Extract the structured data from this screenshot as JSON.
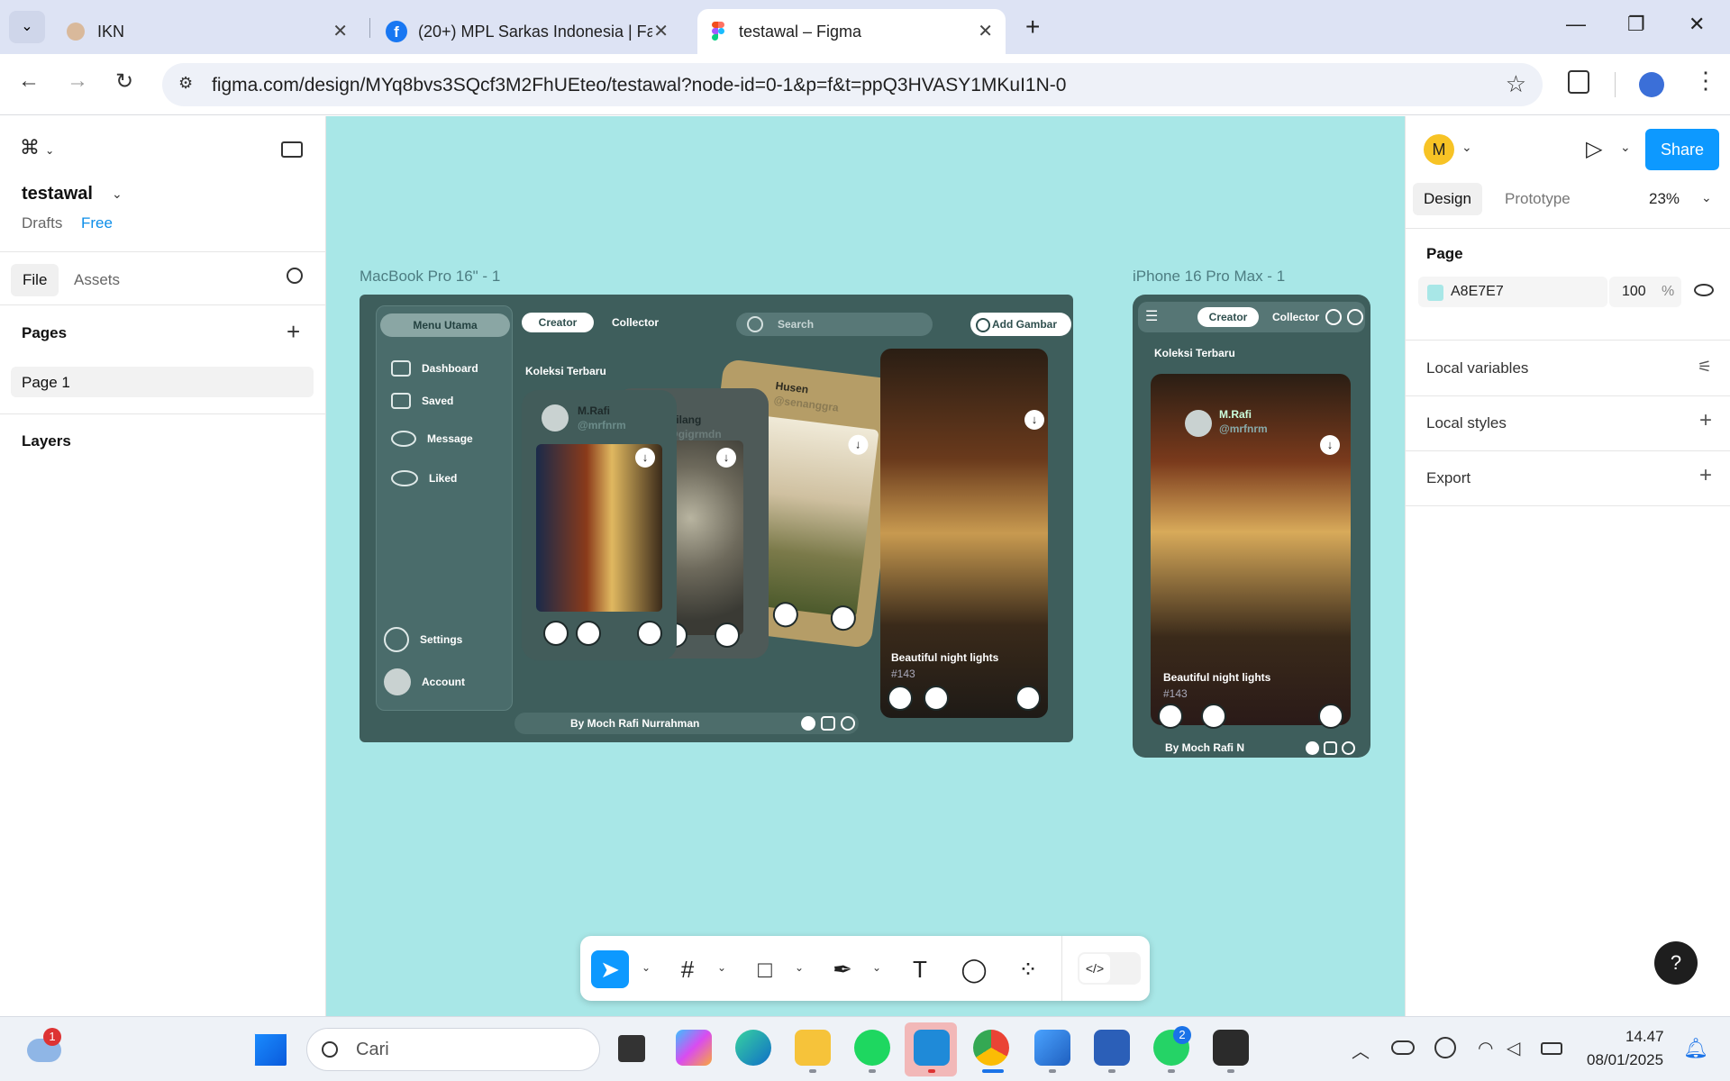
{
  "browser": {
    "tabs": [
      {
        "label": "IKN"
      },
      {
        "label": "(20+) MPL Sarkas Indonesia | Fa"
      },
      {
        "label": "testawal – Figma"
      }
    ],
    "new_tab": "+",
    "url": "figma.com/design/MYq8bvs3SQcf3M2FhUEteo/testawal?node-id=0-1&p=f&t=ppQ3HVASY1MKuI1N-0"
  },
  "left_panel": {
    "file_name": "testawal",
    "drafts": "Drafts",
    "plan": "Free",
    "tabs": [
      "File",
      "Assets"
    ],
    "pages_title": "Pages",
    "pages": [
      "Page 1"
    ],
    "layers_title": "Layers"
  },
  "canvas": {
    "bg_color": "#A8E7E7",
    "mac_label": "MacBook Pro 16\" - 1",
    "iphone_label": "iPhone 16 Pro Max - 1",
    "mac": {
      "menu_title": "Menu Utama",
      "menu_items": [
        "Dashboard",
        "Saved",
        "Message",
        "Liked"
      ],
      "settings": "Settings",
      "account": "Account",
      "creator": "Creator",
      "collector": "Collector",
      "search": "Search",
      "add": "Add Gambar",
      "section": "Koleksi Terbaru",
      "card1_name": "M.Rafi",
      "card1_handle": "@mrfnrm",
      "card2_name": "Gilang",
      "card2_handle": "@gigrmdn",
      "card3_name": "Husen",
      "card3_handle": "@senanggra",
      "big_title": "Beautiful night lights",
      "big_num": "#143",
      "footer": "By Moch Rafi Nurrahman"
    },
    "iphone": {
      "creator": "Creator",
      "collector": "Collector",
      "section": "Koleksi Terbaru",
      "name": "M.Rafi",
      "handle": "@mrfnrm",
      "big_title": "Beautiful night lights",
      "big_num": "#143",
      "footer": "By Moch Rafi N"
    }
  },
  "right_panel": {
    "avatar_letter": "M",
    "share": "Share",
    "tabs": [
      "Design",
      "Prototype"
    ],
    "zoom": "23%",
    "page_title": "Page",
    "page_color": "A8E7E7",
    "opacity": "100",
    "percent": "%",
    "rows": [
      "Local variables",
      "Local styles",
      "Export"
    ],
    "help": "?"
  },
  "taskbar": {
    "search_placeholder": "Cari",
    "time": "14.47",
    "date": "08/01/2025",
    "weather_badge": "1",
    "whatsapp_badge": "2"
  },
  "colors": {
    "accent": "#0d99ff",
    "mac_bg": "#3e5e5c"
  }
}
